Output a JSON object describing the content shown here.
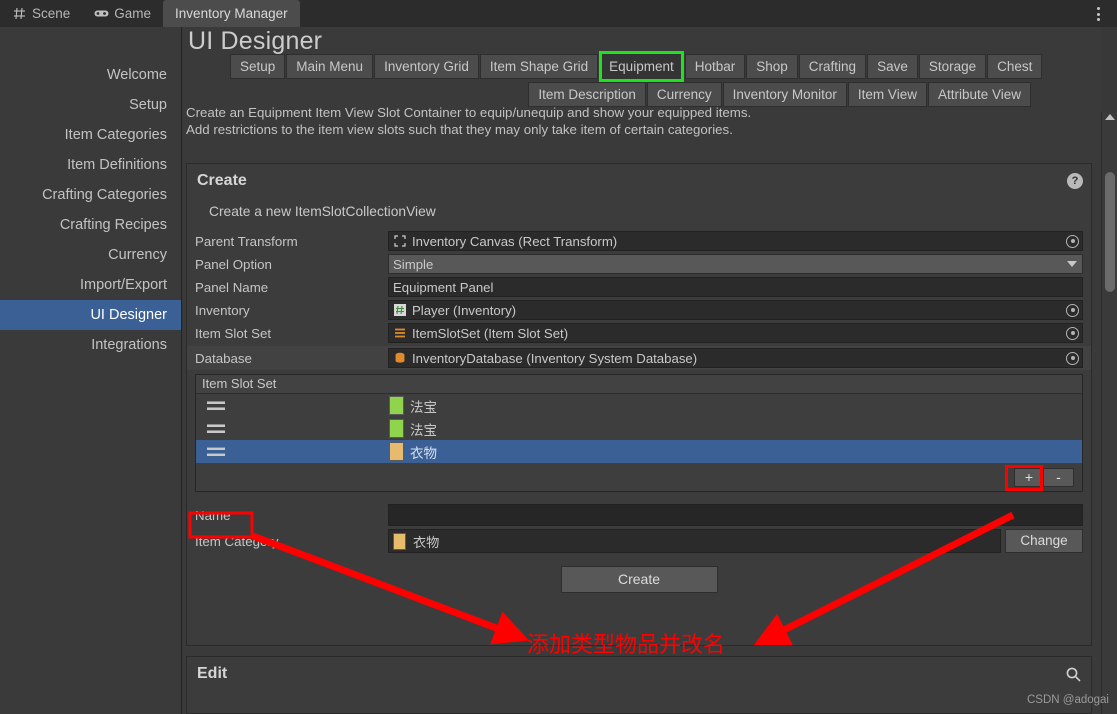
{
  "window": {
    "editor_tabs": [
      {
        "label": "Scene",
        "icon": "grid-icon",
        "active": false
      },
      {
        "label": "Game",
        "icon": "gamepad-icon",
        "active": false
      },
      {
        "label": "Inventory Manager",
        "icon": "none",
        "active": true
      }
    ],
    "menu_icon": "kebab-menu-icon"
  },
  "sidebar": {
    "items": [
      {
        "label": "Welcome",
        "selected": false
      },
      {
        "label": "Setup",
        "selected": false
      },
      {
        "label": "Item Categories",
        "selected": false
      },
      {
        "label": "Item Definitions",
        "selected": false
      },
      {
        "label": "Crafting Categories",
        "selected": false
      },
      {
        "label": "Crafting Recipes",
        "selected": false
      },
      {
        "label": "Currency",
        "selected": false
      },
      {
        "label": "Import/Export",
        "selected": false
      },
      {
        "label": "UI Designer",
        "selected": true
      },
      {
        "label": "Integrations",
        "selected": false
      }
    ]
  },
  "main": {
    "title": "UI Designer",
    "tabs_row1": [
      {
        "label": "Setup",
        "highlighted": false
      },
      {
        "label": "Main Menu",
        "highlighted": false
      },
      {
        "label": "Inventory Grid",
        "highlighted": false
      },
      {
        "label": "Item Shape Grid",
        "highlighted": false
      },
      {
        "label": "Equipment",
        "highlighted": true
      },
      {
        "label": "Hotbar",
        "highlighted": false
      },
      {
        "label": "Shop",
        "highlighted": false
      },
      {
        "label": "Crafting",
        "highlighted": false
      },
      {
        "label": "Save",
        "highlighted": false
      },
      {
        "label": "Storage",
        "highlighted": false
      },
      {
        "label": "Chest",
        "highlighted": false
      }
    ],
    "tabs_row2": [
      {
        "label": "Item Description",
        "highlighted": false
      },
      {
        "label": "Currency",
        "highlighted": false
      },
      {
        "label": "Inventory Monitor",
        "highlighted": false
      },
      {
        "label": "Item View",
        "highlighted": false
      },
      {
        "label": "Attribute View",
        "highlighted": false
      }
    ],
    "description_line1": "Create an Equipment Item View Slot Container to equip/unequip and show your equipped items.",
    "description_line2": "Add restrictions to the item view slots such that they may only take item of certain categories."
  },
  "create_panel": {
    "header": "Create",
    "help_icon": "question-mark-icon",
    "subtitle": "Create a new ItemSlotCollectionView",
    "fields": [
      {
        "label": "Parent Transform",
        "value": "Inventory Canvas (Rect Transform)",
        "icon": "rect-transform-icon",
        "control": "object-picker"
      },
      {
        "label": "Panel Option",
        "value": "Simple",
        "icon": "none",
        "control": "dropdown"
      },
      {
        "label": "Panel Name",
        "value": "Equipment Panel",
        "icon": "none",
        "control": "text-input"
      },
      {
        "label": "Inventory",
        "value": "Player (Inventory)",
        "icon": "script-icon",
        "control": "object-picker"
      },
      {
        "label": "Item Slot Set",
        "value": "ItemSlotSet (Item Slot Set)",
        "icon": "list-icon",
        "control": "object-picker"
      },
      {
        "label": "Database",
        "value": "InventoryDatabase (Inventory System Database)",
        "icon": "database-icon",
        "control": "object-picker"
      }
    ],
    "slot_list": {
      "header": "Item Slot Set",
      "rows": [
        {
          "label": "法宝",
          "color": "#8FD44C",
          "selected": false
        },
        {
          "label": "法宝",
          "color": "#8FD44C",
          "selected": false
        },
        {
          "label": "衣物",
          "color": "#E6BB6E",
          "selected": true
        }
      ],
      "add_button": "+",
      "remove_button": "-"
    },
    "name_field": {
      "label": "Name",
      "value": "",
      "placeholder": ""
    },
    "item_category_field": {
      "label": "Item Category",
      "value": "衣物",
      "color": "#E6BB6E",
      "change_button": "Change"
    },
    "create_button": "Create"
  },
  "edit_panel": {
    "header": "Edit",
    "search_icon": "search-icon"
  },
  "annotations": {
    "note_text": "添加类型物品并改名",
    "note_color": "#ff0000",
    "highlight_color": "#1ee21e",
    "box_color": "#ff0000"
  },
  "watermark": "CSDN @adogai"
}
